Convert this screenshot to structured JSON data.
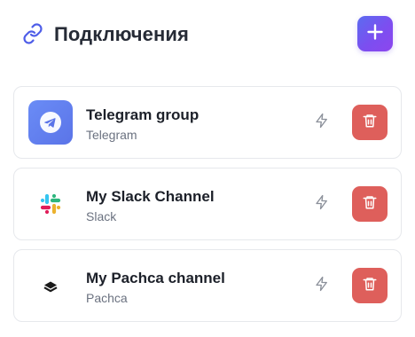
{
  "header": {
    "title": "Подключения",
    "title_icon": "link-icon",
    "add_icon": "plus-icon"
  },
  "colors": {
    "accent_gradient_start": "#5b6cf0",
    "accent_gradient_end": "#8d46ee",
    "delete": "#de5f5b",
    "telegram": "#5b74e8"
  },
  "connections": [
    {
      "name": "Telegram group",
      "type": "Telegram",
      "icon": "telegram-icon",
      "test_icon": "bolt-icon",
      "delete_icon": "trash-icon"
    },
    {
      "name": "My Slack Channel",
      "type": "Slack",
      "icon": "slack-icon",
      "test_icon": "bolt-icon",
      "delete_icon": "trash-icon"
    },
    {
      "name": "My Pachca channel",
      "type": "Pachca",
      "icon": "pachca-icon",
      "test_icon": "bolt-icon",
      "delete_icon": "trash-icon"
    }
  ]
}
